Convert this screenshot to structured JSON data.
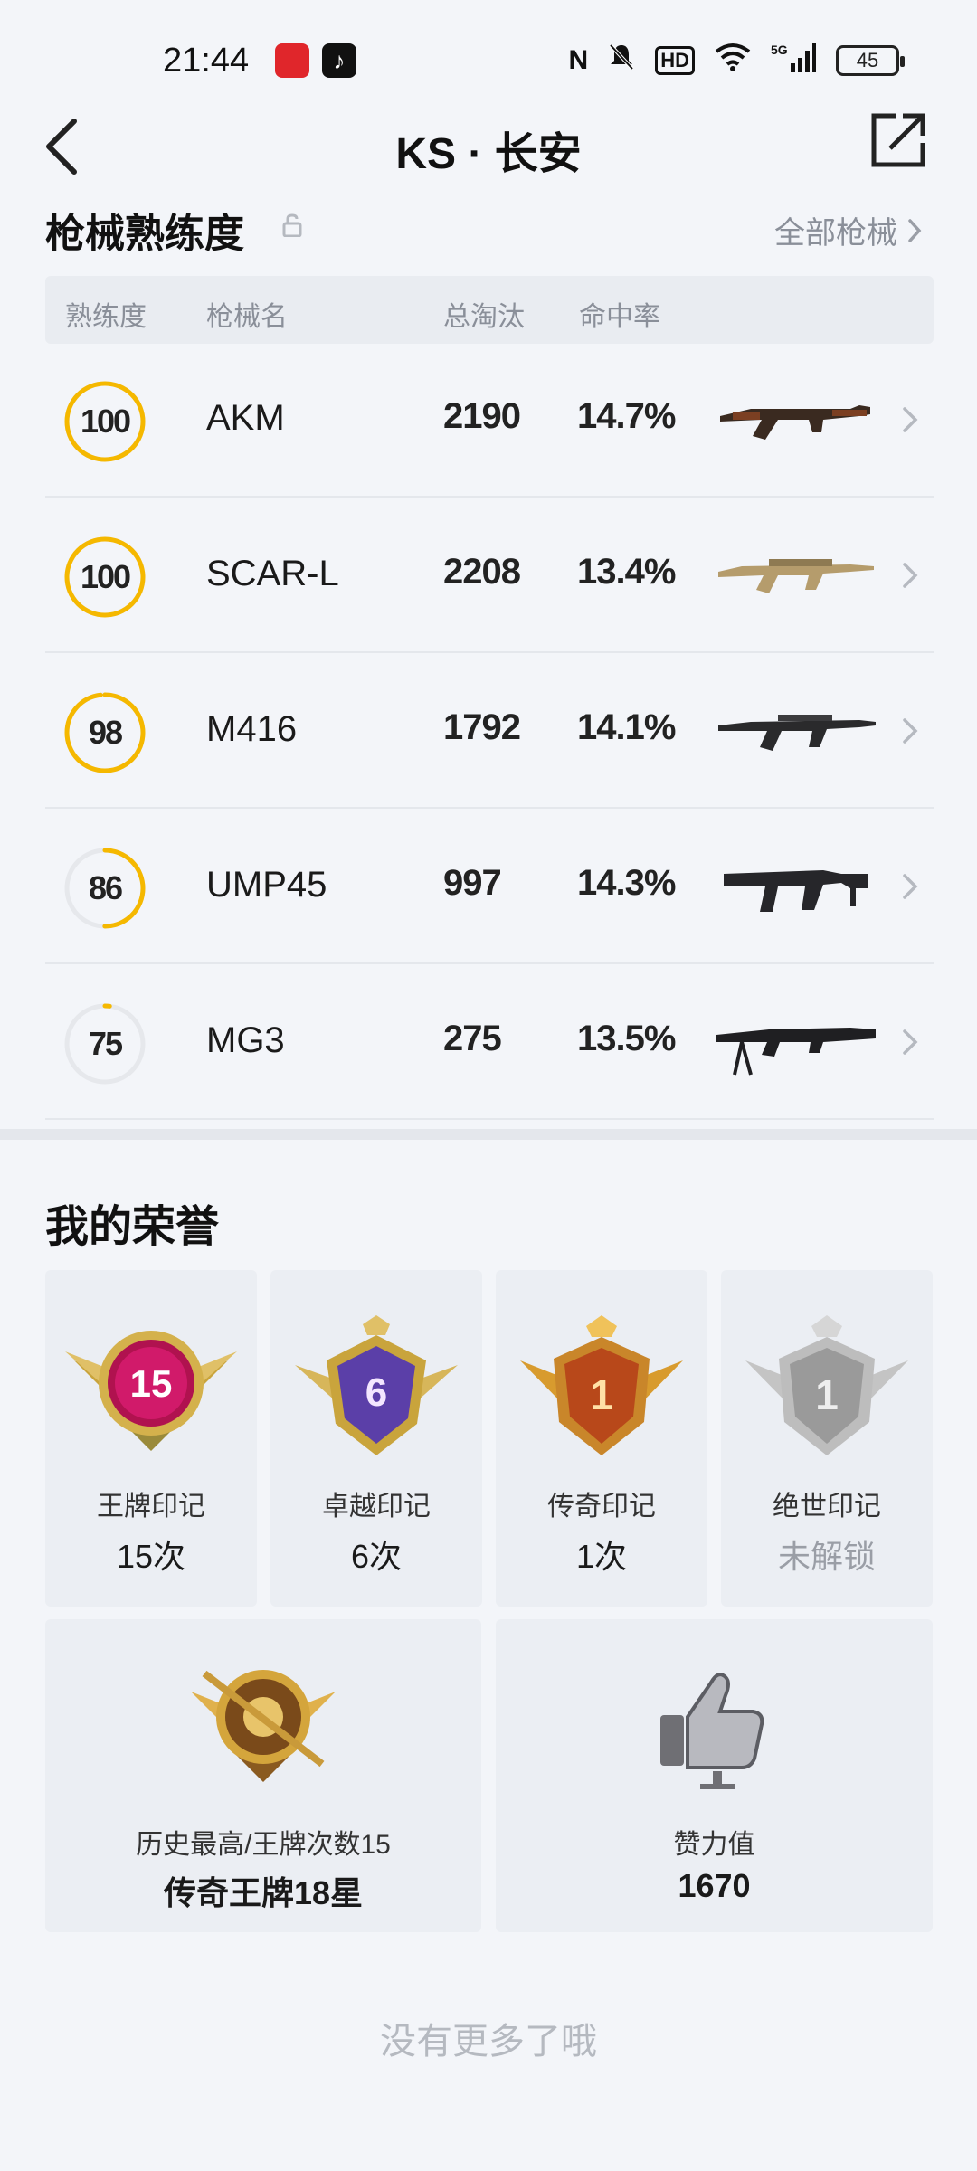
{
  "status_bar": {
    "time": "21:44",
    "battery": "45",
    "icons": [
      "nfc-icon",
      "mute-icon",
      "hd-icon",
      "wifi-icon",
      "5g-signal-icon"
    ]
  },
  "header": {
    "title": "KS · 长安",
    "back_icon": "chevron-left-icon",
    "share_icon": "share-external-icon"
  },
  "weapons": {
    "title": "枪械熟练度",
    "all_link": "全部枪械",
    "columns": [
      "熟练度",
      "枪械名",
      "总淘汰",
      "命中率"
    ],
    "accent": "#f5b800",
    "rows": [
      {
        "mastery": "100",
        "mastery_pct": 100,
        "name": "AKM",
        "kills": "2190",
        "rate": "14.7%",
        "image": "akm-rifle"
      },
      {
        "mastery": "100",
        "mastery_pct": 100,
        "name": "SCAR-L",
        "kills": "2208",
        "rate": "13.4%",
        "image": "scar-rifle"
      },
      {
        "mastery": "98",
        "mastery_pct": 98,
        "name": "M416",
        "kills": "1792",
        "rate": "14.1%",
        "image": "m416-rifle"
      },
      {
        "mastery": "86",
        "mastery_pct": 50,
        "name": "UMP45",
        "kills": "997",
        "rate": "14.3%",
        "image": "ump45-smg"
      },
      {
        "mastery": "75",
        "mastery_pct": 2,
        "name": "MG3",
        "kills": "275",
        "rate": "13.5%",
        "image": "mg3-lmg"
      }
    ]
  },
  "honor": {
    "title": "我的荣誉",
    "cards": [
      {
        "label": "王牌印记",
        "value": "15次",
        "badge_text": "15",
        "badge": "ace-badge"
      },
      {
        "label": "卓越印记",
        "value": "6次",
        "badge_text": "6",
        "badge": "excellence-badge"
      },
      {
        "label": "传奇印记",
        "value": "1次",
        "badge_text": "1",
        "badge": "legend-badge"
      },
      {
        "label": "绝世印记",
        "value": "未解锁",
        "badge_text": "1",
        "badge": "peerless-badge"
      }
    ],
    "wide_cards": [
      {
        "label": "历史最高/王牌次数15",
        "value": "传奇王牌18星",
        "badge": "sniper-rank-badge"
      },
      {
        "label": "赞力值",
        "value": "1670",
        "badge": "thumbs-up-icon"
      }
    ]
  },
  "footer": {
    "end_text": "没有更多了哦"
  }
}
